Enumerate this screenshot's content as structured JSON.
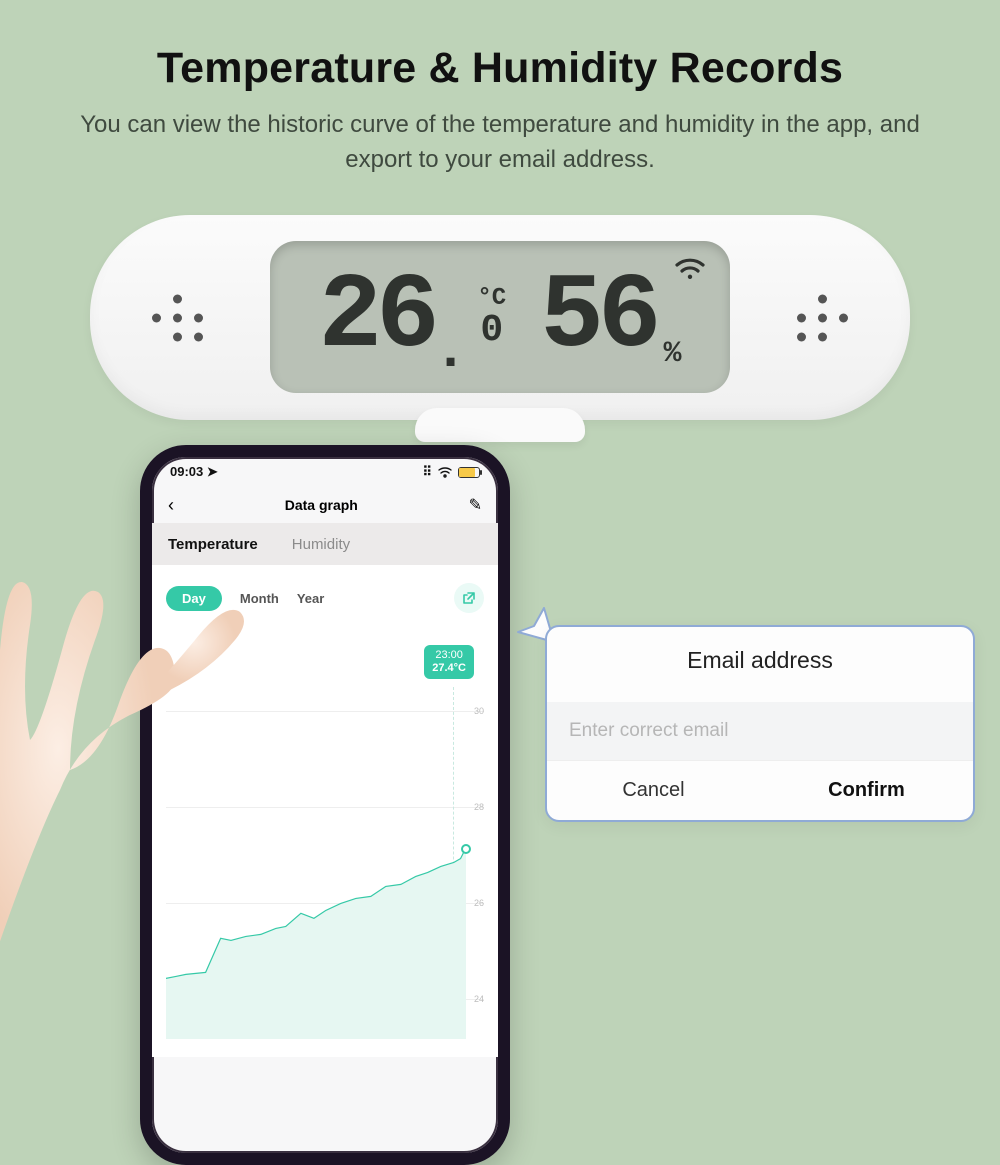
{
  "title": "Temperature & Humidity Records",
  "subtitle": "You can view the historic curve of the temperature and  humidity in the app, and export to your email address.",
  "device": {
    "temp_major": "26",
    "temp_decimal": "0",
    "temp_unit": "°C",
    "humidity": "56",
    "humidity_unit": "%"
  },
  "phone": {
    "time": "09:03",
    "title": "Data graph",
    "tabs": {
      "temperature": "Temperature",
      "humidity": "Humidity"
    },
    "range": {
      "day": "Day",
      "month": "Month",
      "year": "Year"
    },
    "tooltip": {
      "time": "23:00",
      "value": "27.4°C"
    },
    "y_ticks": [
      "30",
      "28",
      "26",
      "24"
    ]
  },
  "popover": {
    "heading": "Email address",
    "placeholder": "Enter correct email",
    "cancel": "Cancel",
    "confirm": "Confirm"
  }
}
